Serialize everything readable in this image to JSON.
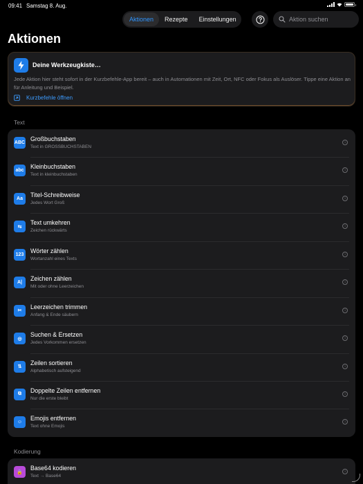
{
  "status": {
    "time": "09:41",
    "date": "Samstag 8. Aug.",
    "battery_percent": 100
  },
  "tabs": [
    {
      "label": "Aktionen",
      "active": true
    },
    {
      "label": "Rezepte",
      "active": false
    },
    {
      "label": "Einstellungen",
      "active": false
    }
  ],
  "search": {
    "placeholder": "Aktion suchen",
    "value": ""
  },
  "page_title": "Aktionen",
  "hint": {
    "title": "Deine Werkzeugkiste…",
    "body": "Jede Aktion hier steht sofort in der Kurzbefehle-App bereit – auch in Automationen mit Zeit, Ort, NFC oder Fokus als Auslöser. Tippe eine Aktion an für Anleitung und Beispiel.",
    "link": "Kurzbefehle öffnen",
    "icon": "bolt-icon"
  },
  "sections": {
    "text": {
      "header": "Text",
      "items": [
        {
          "title": "Großbuchstaben",
          "subtitle": "Text in GROSSBUCHSTABEN",
          "glyph": "ABC",
          "icon": "uppercase-icon"
        },
        {
          "title": "Kleinbuchstaben",
          "subtitle": "Text in kleinbuchstaben",
          "glyph": "abc",
          "icon": "lowercase-icon"
        },
        {
          "title": "Titel-Schreibweise",
          "subtitle": "Jedes Wort Groß",
          "glyph": "Aa",
          "icon": "titlecase-icon"
        },
        {
          "title": "Text umkehren",
          "subtitle": "Zeichen rückwärts",
          "glyph": "⇆",
          "icon": "reverse-arrows-icon"
        },
        {
          "title": "Wörter zählen",
          "subtitle": "Wortanzahl eines Texts",
          "glyph": "123",
          "icon": "numbers-icon"
        },
        {
          "title": "Zeichen zählen",
          "subtitle": "Mit oder ohne Leerzeichen",
          "glyph": "A|",
          "icon": "character-cursor-icon"
        },
        {
          "title": "Leerzeichen trimmen",
          "subtitle": "Anfang & Ende säubern",
          "glyph": "✂",
          "icon": "scissors-icon"
        },
        {
          "title": "Suchen & Ersetzen",
          "subtitle": "Jedes Vorkommen ersetzen",
          "glyph": "◎",
          "icon": "find-replace-icon"
        },
        {
          "title": "Zeilen sortieren",
          "subtitle": "Alphabetisch aufsteigend",
          "glyph": "⇅",
          "icon": "sort-arrows-icon"
        },
        {
          "title": "Doppelte Zeilen entfernen",
          "subtitle": "Nur die erste bleibt",
          "glyph": "⧉",
          "icon": "remove-duplicates-icon"
        },
        {
          "title": "Emojis entfernen",
          "subtitle": "Text ohne Emojis",
          "glyph": "☺",
          "icon": "smiley-icon"
        }
      ]
    },
    "encoding": {
      "header": "Kodierung",
      "items": [
        {
          "title": "Base64 kodieren",
          "subtitle": "Text → Base64",
          "glyph": "🔒",
          "icon": "lock-icon"
        }
      ]
    }
  },
  "colors": {
    "accent": "#2f95ff",
    "icon_blue": "#1e7ce8",
    "icon_purple": "#b84bd9",
    "card_bg": "#1c1c1e",
    "bg": "#000000"
  }
}
